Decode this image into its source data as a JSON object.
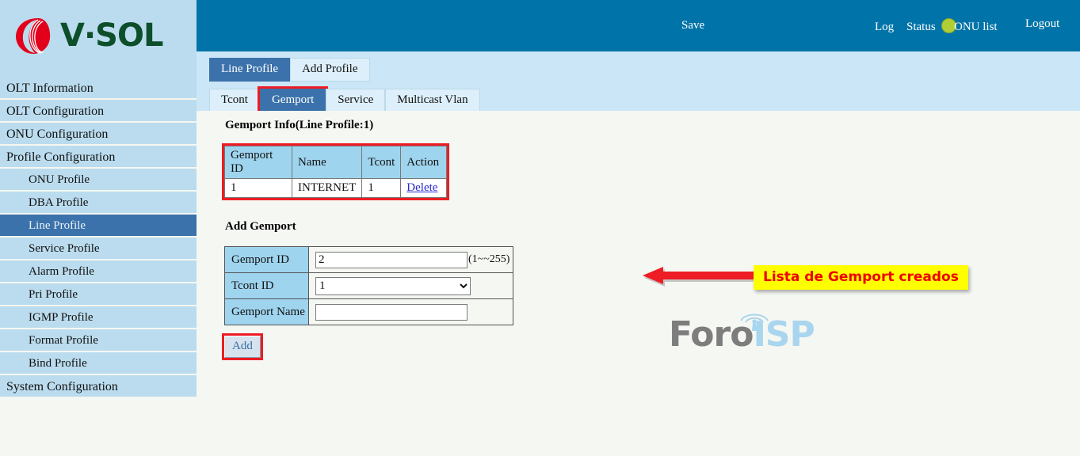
{
  "brand": {
    "logo_text": "V·SOL",
    "logo_icon": "vsol-swirl-logo"
  },
  "header": {
    "save_label": "Save",
    "indicator_color": "#b0cf36",
    "indicator_name": "save-status-indicator",
    "links": [
      {
        "label": "Log",
        "name": "log-link"
      },
      {
        "label": "Status",
        "name": "status-link"
      },
      {
        "label": "ONU list",
        "name": "onu-list-link"
      },
      {
        "label": "Logout",
        "name": "logout-link"
      }
    ]
  },
  "tabs_primary": [
    {
      "label": "Line Profile",
      "selected": true
    },
    {
      "label": "Add Profile",
      "selected": false
    }
  ],
  "tabs_secondary": [
    {
      "label": "Tcont",
      "selected": false,
      "highlighted": false
    },
    {
      "label": "Gemport",
      "selected": true,
      "highlighted": true
    },
    {
      "label": "Service",
      "selected": false,
      "highlighted": false
    },
    {
      "label": "Multicast Vlan",
      "selected": false,
      "highlighted": false
    }
  ],
  "sidebar": {
    "items": [
      {
        "label": "OLT Information",
        "level": 1,
        "active": false
      },
      {
        "label": "OLT Configuration",
        "level": 1,
        "active": false
      },
      {
        "label": "ONU Configuration",
        "level": 1,
        "active": false
      },
      {
        "label": "Profile Configuration",
        "level": 1,
        "active": false
      },
      {
        "label": "ONU Profile",
        "level": 2,
        "active": false
      },
      {
        "label": "DBA Profile",
        "level": 2,
        "active": false
      },
      {
        "label": "Line Profile",
        "level": 2,
        "active": true
      },
      {
        "label": "Service Profile",
        "level": 2,
        "active": false
      },
      {
        "label": "Alarm Profile",
        "level": 2,
        "active": false
      },
      {
        "label": "Pri Profile",
        "level": 2,
        "active": false
      },
      {
        "label": "IGMP Profile",
        "level": 2,
        "active": false
      },
      {
        "label": "Format Profile",
        "level": 2,
        "active": false
      },
      {
        "label": "Bind Profile",
        "level": 2,
        "active": false
      },
      {
        "label": "System Configuration",
        "level": 1,
        "active": false
      }
    ]
  },
  "main": {
    "info_title": "Gemport Info(Line Profile:1)",
    "info_table": {
      "headers": [
        "Gemport ID",
        "Name",
        "Tcont",
        "Action"
      ],
      "rows": [
        {
          "gemport_id": "1",
          "name": "INTERNET",
          "tcont": "1",
          "action": "Delete"
        }
      ]
    },
    "add_title": "Add Gemport",
    "form": {
      "gemport_id_label": "Gemport ID",
      "gemport_id_value": "2",
      "gemport_id_hint": "(1~~255)",
      "tcont_id_label": "Tcont ID",
      "tcont_id_value": "1",
      "tcont_id_options": [
        "1"
      ],
      "gemport_name_label": "Gemport Name",
      "gemport_name_value": "",
      "gemport_name_placeholder": "",
      "add_label": "Add"
    }
  },
  "annotation": {
    "text": "Lista de Gemport creados",
    "text_color": "#ee0000",
    "background_color": "#ffff00",
    "arrow_color": "#ee1c24",
    "arrow_name": "red-left-arrow-icon"
  },
  "watermark": {
    "part1": "Foro",
    "part2": "ISP",
    "part1_color": "#7d7d7d",
    "part2_color": "#a9d5ef",
    "icon": "antenna-tower-icon"
  }
}
